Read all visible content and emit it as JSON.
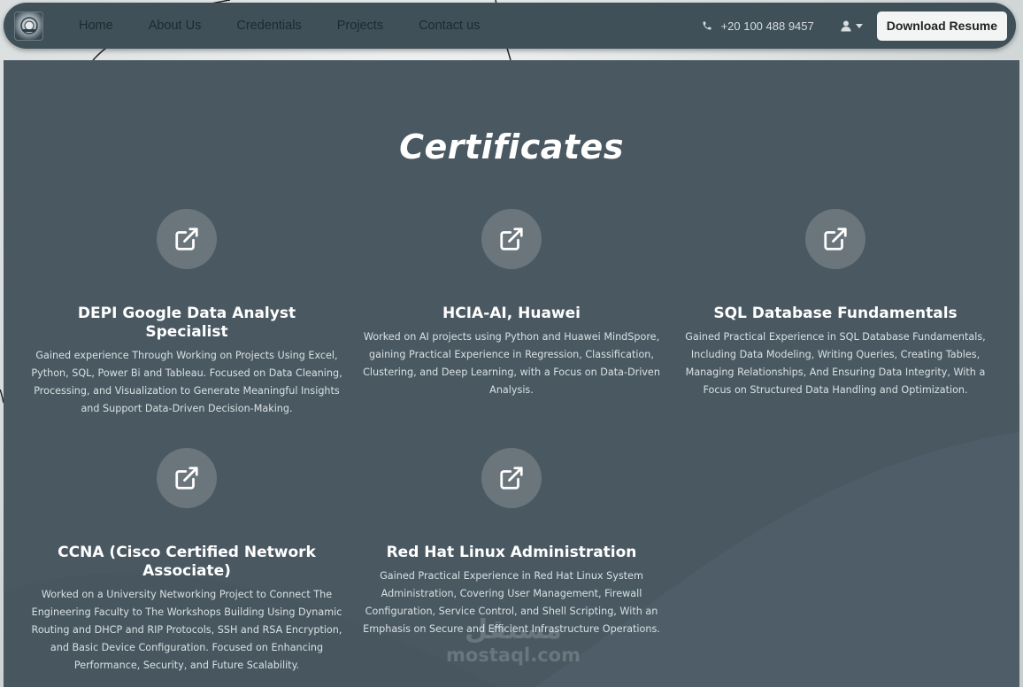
{
  "nav": {
    "links": [
      "Home",
      "About Us",
      "Credentials",
      "Projects",
      "Contact us"
    ],
    "phone": "+20 100 488 9457",
    "resume_label": "Download Resume"
  },
  "section": {
    "title": "Certificates"
  },
  "certificates": [
    {
      "title": "DEPI Google Data Analyst Specialist",
      "description": "Gained experience Through Working on Projects Using Excel, Python, SQL, Power Bi and Tableau. Focused on Data Cleaning, Processing, and Visualization to Generate Meaningful Insights and Support Data-Driven Decision-Making."
    },
    {
      "title": "HCIA-AI, Huawei",
      "description": "Worked on AI projects using Python and Huawei MindSpore, gaining Practical Experience in Regression, Classification, Clustering, and Deep Learning, with a Focus on Data-Driven Analysis."
    },
    {
      "title": "SQL Database Fundamentals",
      "description": "Gained Practical Experience in SQL Database Fundamentals, Including Data Modeling, Writing Queries, Creating Tables, Managing Relationships, And Ensuring Data Integrity, With a Focus on Structured Data Handling and Optimization."
    },
    {
      "title": "CCNA (Cisco Certified Network Associate)",
      "description": "Worked on a University Networking Project to Connect The Engineering Faculty to The Workshops Building Using Dynamic Routing and DHCP and RIP Protocols, SSH and RSA Encryption, and Basic Device Configuration. Focused on Enhancing Performance, Security, and Future Scalability."
    },
    {
      "title": "Red Hat Linux Administration",
      "description": "Gained Practical Experience in Red Hat Linux System Administration, Covering User Management, Firewall Configuration, Service Control, and Shell Scripting, With an Emphasis on Secure and Efficient Infrastructure Operations."
    }
  ],
  "watermark": {
    "arabic": "مستقل",
    "latin": "mostaql.com"
  },
  "colors": {
    "navbar": "#3f5058",
    "panel": "#4a5861",
    "icon_circle": "#6b767c",
    "title_text": "#ffffff",
    "desc_text": "#d8e1e4",
    "resume_button": "#f3f5f5"
  },
  "icons": {
    "logo": "portfolio-logo",
    "phone": "phone-icon",
    "user": "user-icon",
    "card": "external-link-icon"
  }
}
